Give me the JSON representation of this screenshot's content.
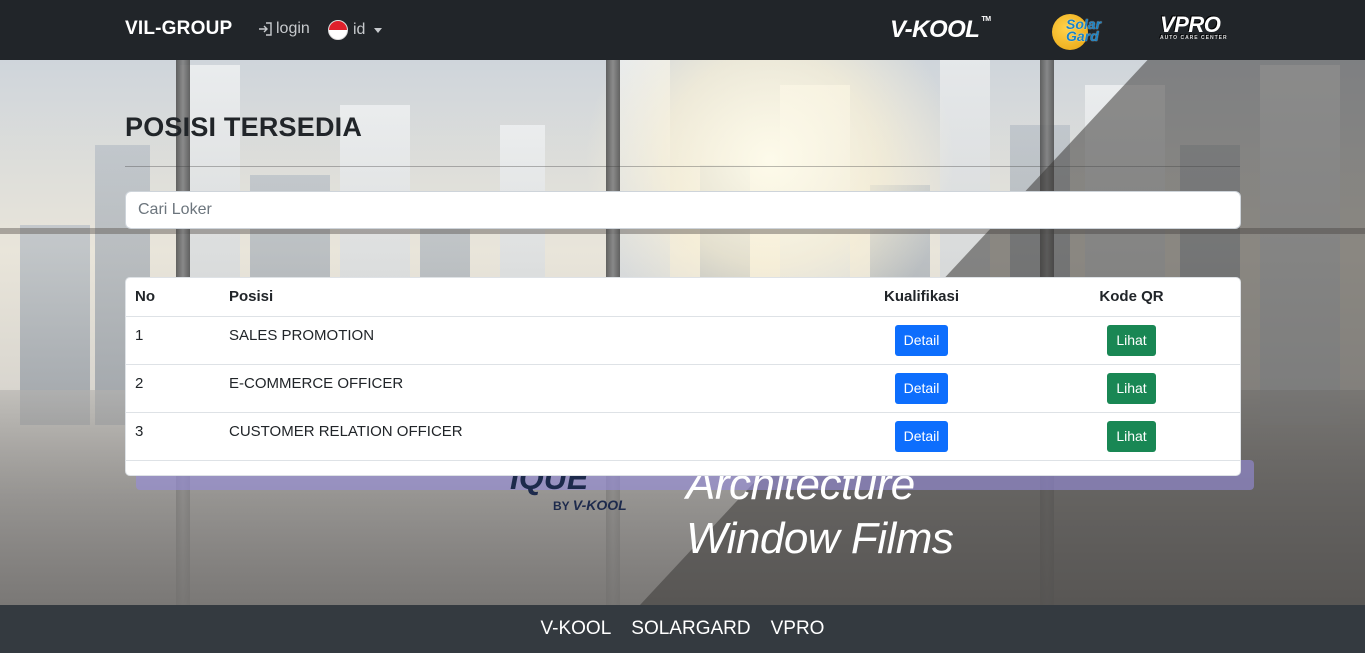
{
  "navbar": {
    "brand": "VIL-GROUP",
    "login_label": "login",
    "language_label": "id",
    "partner_logos": {
      "vkool": "V-KOOL",
      "vkool_tm": "TM",
      "solargard": "Solar Gard",
      "vpro": "VPRO",
      "vpro_sub": "AUTO CARE CENTER"
    }
  },
  "hero": {
    "brand_text": "IQUE",
    "by_text": "BY",
    "by_brand": "V-KOOL",
    "line1": "Architecture",
    "line2": "Window Films"
  },
  "main": {
    "title": "POSISI TERSEDIA",
    "search_placeholder": "Cari Loker",
    "table": {
      "headers": [
        "No",
        "Posisi",
        "Kualifikasi",
        "Kode QR"
      ],
      "rows": [
        {
          "no": "1",
          "posisi": "SALES PROMOTION",
          "kualifikasi": "Detail",
          "kode_qr": "Lihat"
        },
        {
          "no": "2",
          "posisi": "E-COMMERCE OFFICER",
          "kualifikasi": "Detail",
          "kode_qr": "Lihat"
        },
        {
          "no": "3",
          "posisi": "CUSTOMER RELATION OFFICER",
          "kualifikasi": "Detail",
          "kode_qr": "Lihat"
        }
      ]
    }
  },
  "footer": {
    "links": [
      "V-KOOL",
      "SOLARGARD",
      "VPRO"
    ]
  },
  "colors": {
    "navbar": "#212529",
    "footer": "#343a40",
    "detail_button": "#0d6efd",
    "lihat_button": "#198754"
  },
  "icons": {
    "login": "login-icon",
    "language": "indonesia-flag-icon",
    "dropdown": "caret-down-icon"
  }
}
